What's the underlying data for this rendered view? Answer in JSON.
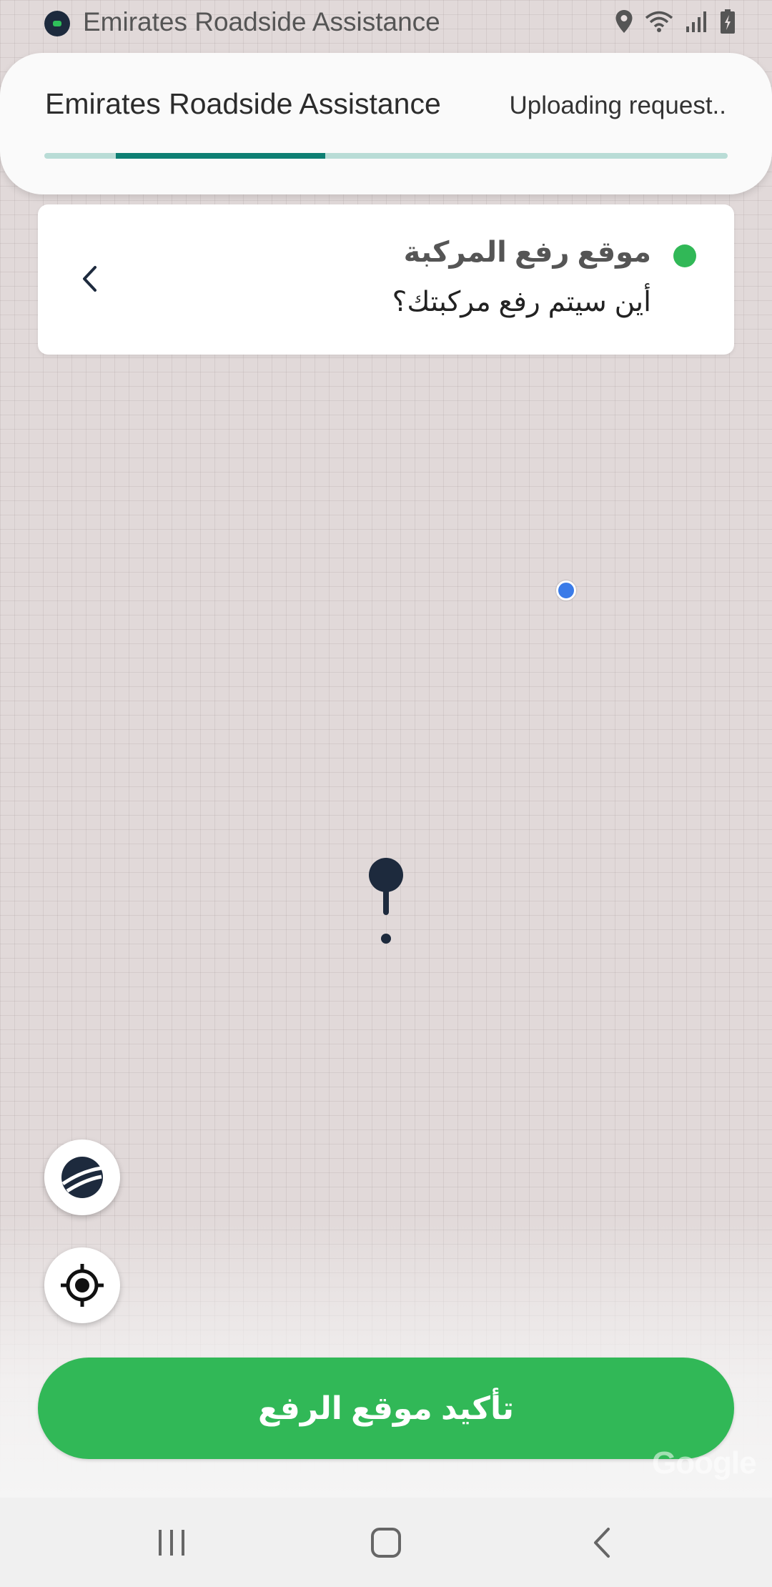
{
  "status_bar": {
    "app_title": "Emirates Roadside Assistance",
    "icons": [
      "location-icon",
      "wifi-icon",
      "signal-icon",
      "battery-icon"
    ]
  },
  "header": {
    "title": "Emirates Roadside Assistance",
    "status_text": "Uploading request..",
    "progress": 0.36
  },
  "location_card": {
    "title": "موقع رفع المركبة",
    "subtitle": "أين سيتم رفع مركبتك؟",
    "status_color": "#31b857"
  },
  "map": {
    "watermark": "Google"
  },
  "actions": {
    "confirm_label": "تأكيد موقع الرفع"
  },
  "colors": {
    "accent": "#31b857",
    "progress": "#0e7f73",
    "marker": "#1d2a3d",
    "current_location": "#3a7be8"
  }
}
